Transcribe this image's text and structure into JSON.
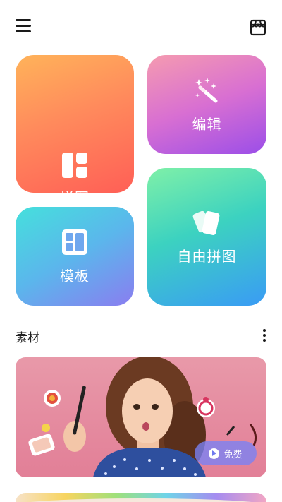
{
  "header": {
    "menu_icon": "hamburger-menu-icon",
    "store_icon": "store-icon"
  },
  "tiles": {
    "collage": {
      "label": "拼图",
      "icon": "collage-layout-icon",
      "gradient": [
        "#ffb35a",
        "#ff5f56"
      ]
    },
    "edit": {
      "label": "编辑",
      "icon": "magic-wand-icon",
      "gradient": [
        "#f59bb0",
        "#9b4ee8"
      ]
    },
    "template": {
      "label": "模板",
      "icon": "template-grid-icon",
      "gradient": [
        "#45e0dc",
        "#8a7df0"
      ]
    },
    "free_collage": {
      "label": "自由拼图",
      "icon": "photo-cards-icon",
      "gradient": [
        "#7ff0a8",
        "#3a9bf5"
      ]
    }
  },
  "materials": {
    "title": "素材",
    "more_icon": "more-vertical-icon",
    "banner": {
      "badge_label": "免费",
      "badge_icon": "play-circle-icon"
    }
  }
}
